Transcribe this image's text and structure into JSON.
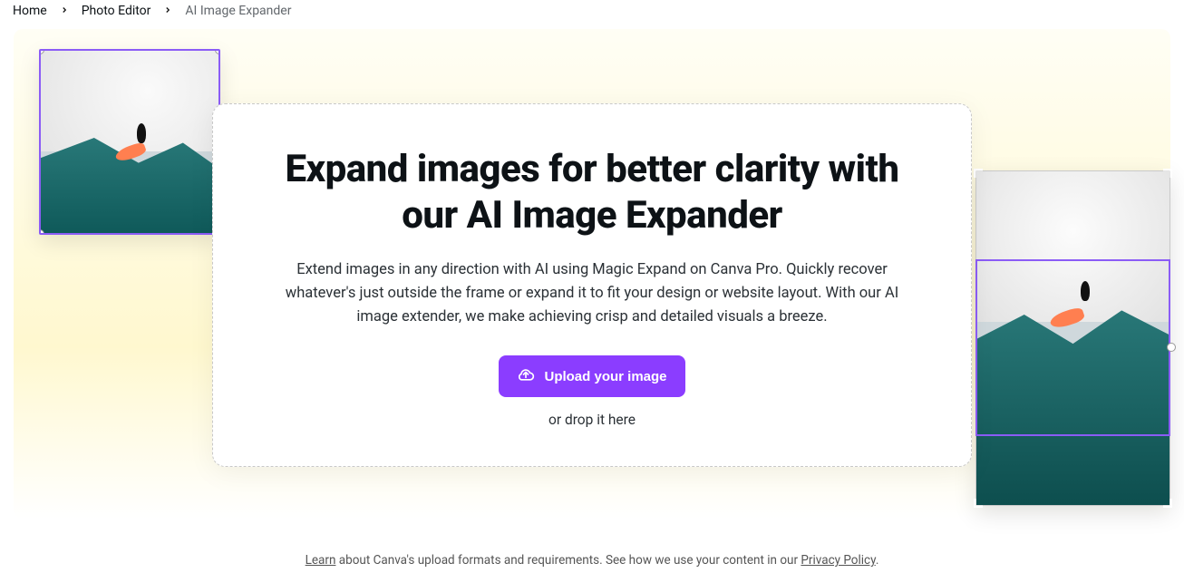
{
  "breadcrumb": {
    "home": "Home",
    "photo_editor": "Photo Editor",
    "current": "AI Image Expander"
  },
  "hero": {
    "title": "Expand images for better clarity with our AI Image Expander",
    "description": "Extend images in any direction with AI using Magic Expand on Canva Pro. Quickly recover whatever's just outside the frame or expand it to fit your design or website layout. With our AI image extender, we make achieving crisp and detailed visuals a breeze.",
    "upload_label": "Upload your image",
    "drop_hint": "or drop it here"
  },
  "footer": {
    "learn_link": "Learn",
    "text_mid": " about Canva's upload formats and requirements. See how we use your content in our ",
    "privacy_link": "Privacy Policy",
    "period": "."
  },
  "colors": {
    "accent": "#8b3dff",
    "selection": "#8b5cf6"
  }
}
